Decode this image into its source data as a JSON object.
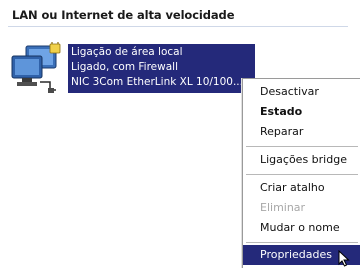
{
  "group": {
    "header": "LAN ou Internet de alta velocidade"
  },
  "connection": {
    "name": "Ligação de área local",
    "status": "Ligado, com Firewall",
    "device": "NIC 3Com EtherLink XL 10/100...",
    "icon": "network-connection-icon"
  },
  "context_menu": {
    "items": [
      {
        "label": "Desactivar",
        "bold": false,
        "disabled": false
      },
      {
        "label": "Estado",
        "bold": true,
        "disabled": false
      },
      {
        "label": "Reparar",
        "bold": false,
        "disabled": false
      },
      {
        "label": "Ligações bridge",
        "bold": false,
        "disabled": false
      },
      {
        "label": "Criar atalho",
        "bold": false,
        "disabled": false
      },
      {
        "label": "Eliminar",
        "bold": false,
        "disabled": true
      },
      {
        "label": "Mudar o nome",
        "bold": false,
        "disabled": false
      },
      {
        "label": "Propriedades",
        "bold": false,
        "disabled": false,
        "selected": true
      }
    ]
  },
  "colors": {
    "selection": "#24297a",
    "disabled_text": "#a8a8a8"
  }
}
